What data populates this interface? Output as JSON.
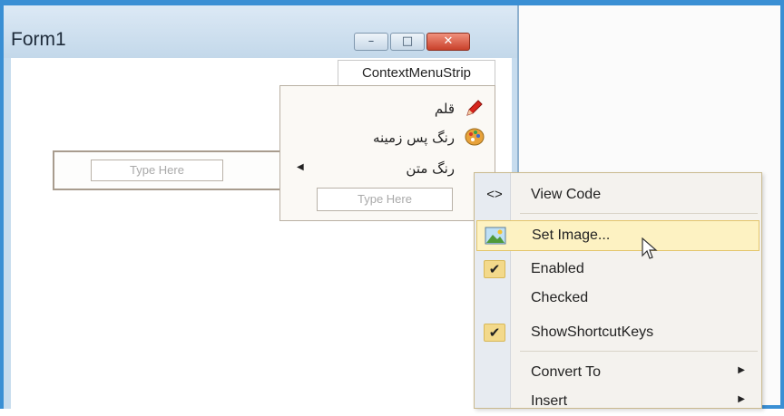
{
  "form": {
    "title": "Form1"
  },
  "window_controls": {
    "minimize": "–",
    "maximize": "□",
    "close": "✕"
  },
  "menustrip": {
    "typehere": "Type Here"
  },
  "context_menu_strip": {
    "tab_label": "ContextMenuStrip",
    "items": [
      {
        "label": "قلم",
        "icon": "pen-icon"
      },
      {
        "label": "رنگ پس زمینه",
        "icon": "palette-icon"
      },
      {
        "label": "رنگ متن",
        "icon": "arrow-left-icon"
      }
    ],
    "typehere": "Type Here"
  },
  "popup_menu": {
    "items": [
      {
        "label": "View Code",
        "icon": "code-icon"
      },
      {
        "label": "Set Image...",
        "icon": "image-icon",
        "highlighted": true
      },
      {
        "label": "Enabled",
        "checked": true
      },
      {
        "label": "Checked",
        "checked": false
      },
      {
        "label": "ShowShortcutKeys",
        "checked": true
      },
      {
        "label": "Convert To",
        "submenu": true
      },
      {
        "label": "Insert",
        "submenu": true
      }
    ]
  },
  "colors": {
    "frame_blue": "#3a8fd4",
    "highlight": "#fdf2c2",
    "check_bg": "#f3d98b"
  }
}
